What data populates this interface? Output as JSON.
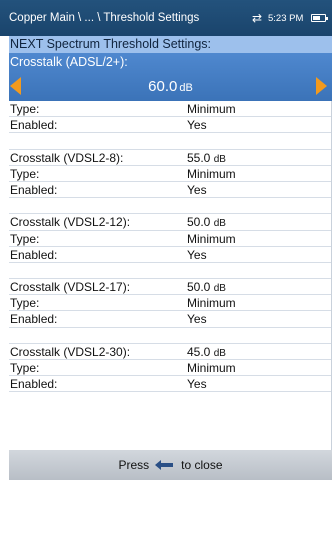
{
  "header": {
    "breadcrumb": "Copper Main \\ ... \\ Threshold Settings",
    "time": "5:23 PM"
  },
  "section_title": "NEXT Spectrum Threshold Settings:",
  "selector": {
    "label": "Crosstalk (ADSL/2+):",
    "value": "60.0",
    "unit": "dB"
  },
  "first_block": {
    "type_label": "Type:",
    "type_value": "Minimum",
    "enabled_label": "Enabled:",
    "enabled_value": "Yes"
  },
  "blocks": [
    {
      "name": "Crosstalk (VDSL2-8):",
      "value": "55.0",
      "unit": "dB",
      "type_label": "Type:",
      "type_value": "Minimum",
      "enabled_label": "Enabled:",
      "enabled_value": "Yes"
    },
    {
      "name": "Crosstalk (VDSL2-12):",
      "value": "50.0",
      "unit": "dB",
      "type_label": "Type:",
      "type_value": "Minimum",
      "enabled_label": "Enabled:",
      "enabled_value": "Yes"
    },
    {
      "name": "Crosstalk (VDSL2-17):",
      "value": "50.0",
      "unit": "dB",
      "type_label": "Type:",
      "type_value": "Minimum",
      "enabled_label": "Enabled:",
      "enabled_value": "Yes"
    },
    {
      "name": "Crosstalk (VDSL2-30):",
      "value": "45.0",
      "unit": "dB",
      "type_label": "Type:",
      "type_value": "Minimum",
      "enabled_label": "Enabled:",
      "enabled_value": "Yes"
    }
  ],
  "footer": {
    "press": "Press",
    "to_close": "to close"
  },
  "colors": {
    "title_bar": "#1f4b76",
    "section_header": "#9dc0ec",
    "selected_row": "#4680c6",
    "arrows": "#f29a1e",
    "footer": "#c5cbd2"
  },
  "icons": [
    "network-icon",
    "battery-icon",
    "left-arrow-icon",
    "right-arrow-icon",
    "back-enter-icon"
  ]
}
